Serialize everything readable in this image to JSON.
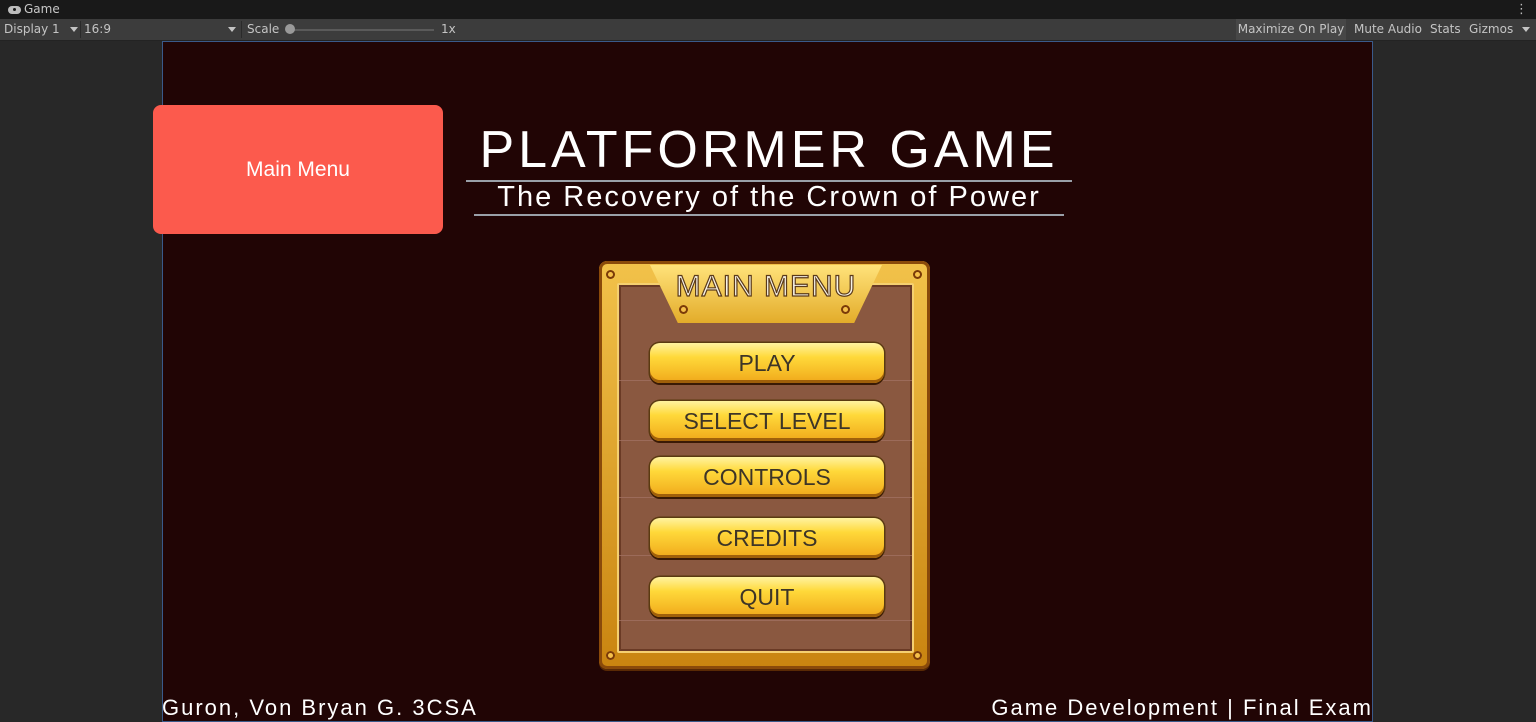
{
  "window": {
    "tab_title": "Game",
    "tab_icon": "gamepad-icon"
  },
  "toolbar": {
    "display": "Display 1",
    "aspect": "16:9",
    "scale_label": "Scale",
    "scale_value": "1x",
    "maximize_on_play": "Maximize On Play",
    "mute_audio": "Mute Audio",
    "stats": "Stats",
    "gizmos": "Gizmos"
  },
  "game": {
    "scene_badge": "Main Menu",
    "title": "PLATFORMER GAME",
    "subtitle": "The Recovery of the Crown of Power",
    "menu_title": "MAIN MENU",
    "buttons": [
      "PLAY",
      "SELECT LEVEL",
      "CONTROLS",
      "CREDITS",
      "QUIT"
    ],
    "footer_left": "Guron, Von Bryan G. 3CSA",
    "footer_right": "Game Development | Final Exam"
  },
  "colors": {
    "viewport_bg": "#210505",
    "badge": "#fc5a4d",
    "button_gold": "#ffd93a",
    "panel_gold": "#f2c24a",
    "panel_wood": "#8a5840"
  }
}
